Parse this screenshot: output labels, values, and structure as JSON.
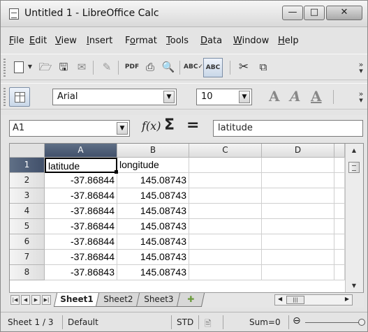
{
  "window": {
    "title": "Untitled 1 - LibreOffice Calc",
    "min_label": "—",
    "max_label": "□",
    "close_label": "✕"
  },
  "menu": [
    "File",
    "Edit",
    "View",
    "Insert",
    "Format",
    "Tools",
    "Data",
    "Window",
    "Help"
  ],
  "menu_underline": [
    "F",
    "E",
    "V",
    "I",
    "o",
    "T",
    "D",
    "W",
    "H"
  ],
  "toolbar_format": {
    "font_name": "Arial",
    "font_size": "10"
  },
  "formula_bar": {
    "cell_ref": "A1",
    "fx": "f(x)",
    "sigma": "Σ",
    "equals": "=",
    "content": "latitude"
  },
  "grid": {
    "columns": [
      "A",
      "B",
      "C",
      "D"
    ],
    "rows": [
      {
        "num": "1",
        "a": "latitude",
        "b": "longitude"
      },
      {
        "num": "2",
        "a": "-37.86844",
        "b": "145.08743"
      },
      {
        "num": "3",
        "a": "-37.86844",
        "b": "145.08743"
      },
      {
        "num": "4",
        "a": "-37.86844",
        "b": "145.08743"
      },
      {
        "num": "5",
        "a": "-37.86844",
        "b": "145.08743"
      },
      {
        "num": "6",
        "a": "-37.86844",
        "b": "145.08743"
      },
      {
        "num": "7",
        "a": "-37.86844",
        "b": "145.08743"
      },
      {
        "num": "8",
        "a": "-37.86843",
        "b": "145.08743"
      }
    ]
  },
  "sheets": [
    "Sheet1",
    "Sheet2",
    "Sheet3"
  ],
  "statusbar": {
    "sheet": "Sheet 1 / 3",
    "style": "Default",
    "mode": "STD",
    "sum": "Sum=0"
  }
}
